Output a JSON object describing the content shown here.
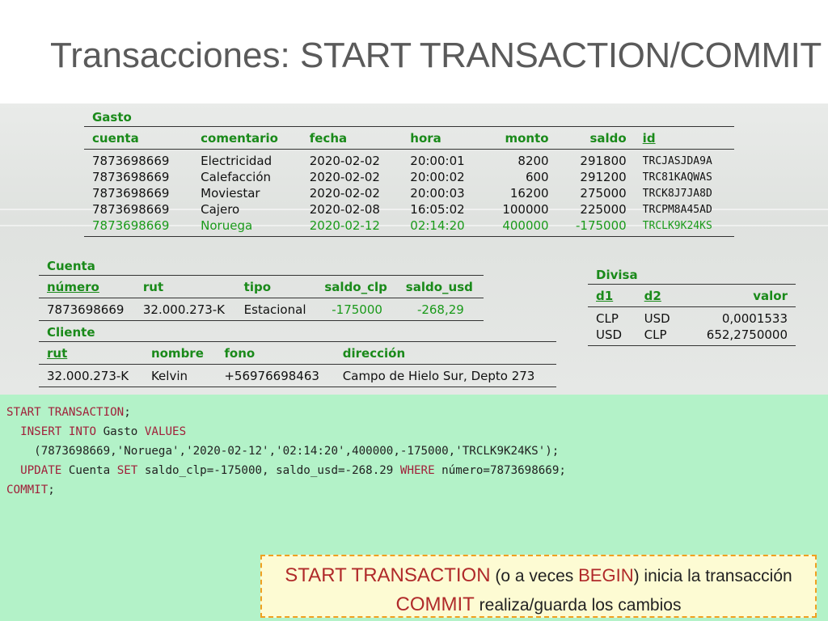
{
  "title": {
    "prefix": "Transacciones:",
    "keywords": "START TRANSACTION/COMMIT"
  },
  "gasto": {
    "title": "Gasto",
    "headers": [
      "cuenta",
      "comentario",
      "fecha",
      "hora",
      "monto",
      "saldo",
      "id"
    ],
    "rows": [
      [
        "7873698669",
        "Electricidad",
        "2020-02-02",
        "20:00:01",
        "8200",
        "291800",
        "TRCJASJDA9A"
      ],
      [
        "7873698669",
        "Calefacción",
        "2020-02-02",
        "20:00:02",
        "600",
        "291200",
        "TRC81KAQWAS"
      ],
      [
        "7873698669",
        "Moviestar",
        "2020-02-02",
        "20:00:03",
        "16200",
        "275000",
        "TRCK8J7JA8D"
      ],
      [
        "7873698669",
        "Cajero",
        "2020-02-08",
        "16:05:02",
        "100000",
        "225000",
        "TRCPM8A45AD"
      ],
      [
        "7873698669",
        "Noruega",
        "2020-02-12",
        "02:14:20",
        "400000",
        "-175000",
        "TRCLK9K24KS"
      ]
    ]
  },
  "cuenta": {
    "title": "Cuenta",
    "headers": [
      "número",
      "rut",
      "tipo",
      "saldo_clp",
      "saldo_usd"
    ],
    "row": [
      "7873698669",
      "32.000.273-K",
      "Estacional",
      "-175000",
      "-268,29"
    ]
  },
  "cliente": {
    "title": "Cliente",
    "headers": [
      "rut",
      "nombre",
      "fono",
      "dirección"
    ],
    "row": [
      "32.000.273-K",
      "Kelvin",
      "+56976698463",
      "Campo de Hielo Sur, Depto 273"
    ]
  },
  "divisa": {
    "title": "Divisa",
    "headers": [
      "d1",
      "d2",
      "valor"
    ],
    "rows": [
      [
        "CLP",
        "USD",
        "0,0001533"
      ],
      [
        "USD",
        "CLP",
        "652,2750000"
      ]
    ]
  },
  "sql": {
    "l1_kw": "START TRANSACTION",
    "l1_rest": ";",
    "l2_indent": "  ",
    "l2_kw1": "INSERT INTO",
    "l2_mid": " Gasto ",
    "l2_kw2": "VALUES",
    "l3": "    (7873698669,'Noruega','2020-02-12','02:14:20',400000,-175000,'TRCLK9K24KS');",
    "l4_indent": "  ",
    "l4_kw1": "UPDATE",
    "l4_mid1": " Cuenta ",
    "l4_kw2": "SET",
    "l4_mid2": " saldo_clp=-175000, saldo_usd=-268.29 ",
    "l4_kw3": "WHERE",
    "l4_end": " número=7873698669;",
    "l5_kw": "COMMIT",
    "l5_rest": ";"
  },
  "note": {
    "l1_kw": "START TRANSACTION",
    "l1_a": " (o a veces ",
    "l1_kw2": "BEGIN",
    "l1_b": ") inicia la transacción",
    "l2_kw": "COMMIT",
    "l2_rest": " realiza/guarda los cambios"
  },
  "colors": {
    "table_header": "#1a8a1a",
    "sql_keyword": "#a0213a",
    "sql_background": "#b3f2c8",
    "note_border": "#f0a020"
  }
}
